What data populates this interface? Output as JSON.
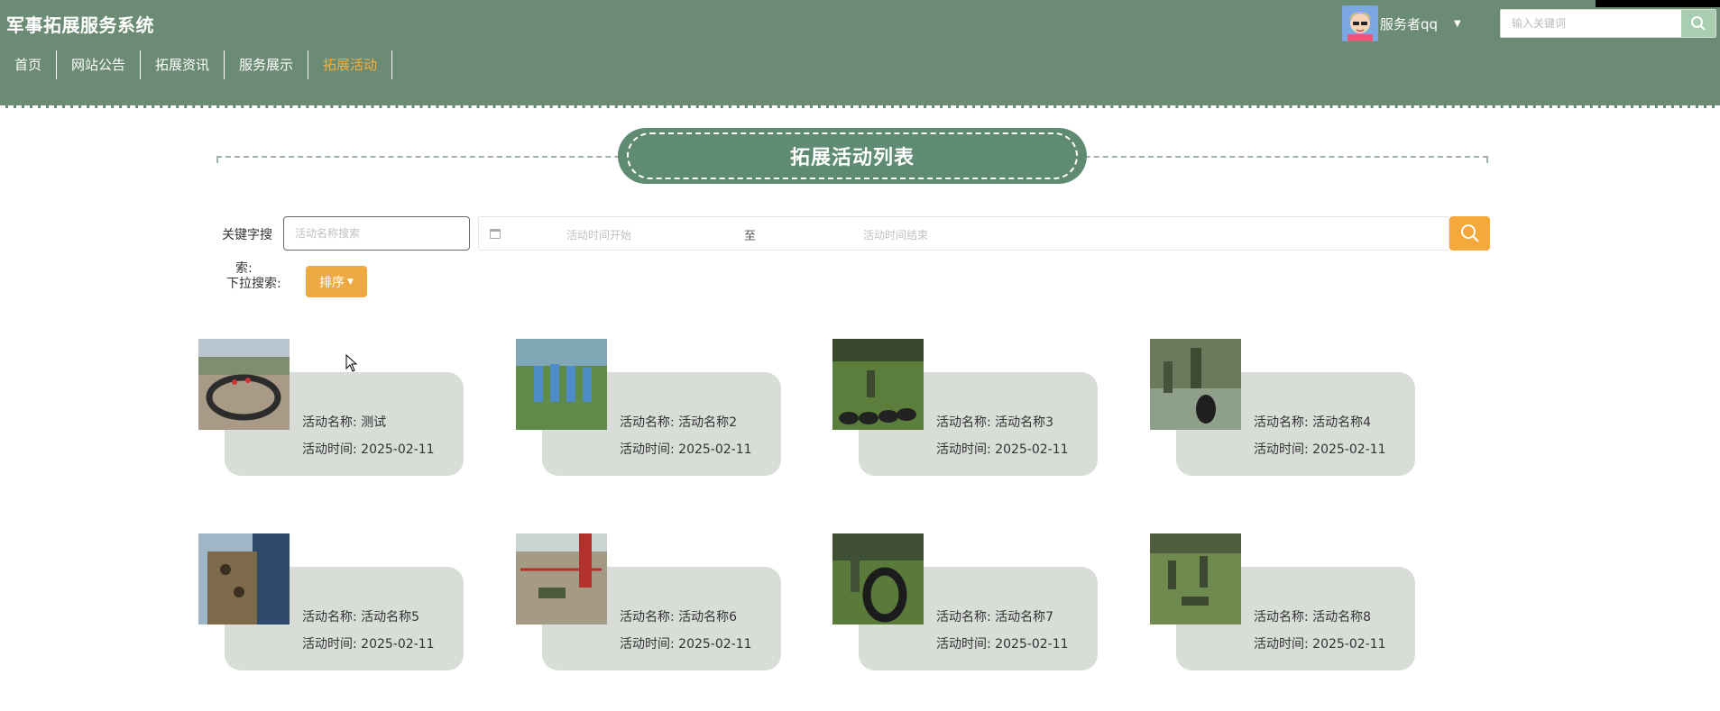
{
  "header": {
    "site_title": "军事拓展服务系统",
    "nav": [
      {
        "label": "首页",
        "active": false
      },
      {
        "label": "网站公告",
        "active": false
      },
      {
        "label": "拓展资讯",
        "active": false
      },
      {
        "label": "服务展示",
        "active": false
      },
      {
        "label": "拓展活动",
        "active": true
      }
    ],
    "user_name": "服务者qq",
    "search_placeholder": "输入关键词",
    "bg_color": "#6b8b74",
    "active_color": "#f1b03e"
  },
  "section": {
    "title": "拓展活动列表"
  },
  "filters": {
    "keyword_label_line1": "关键字搜",
    "keyword_label_line2": "索:",
    "keyword_placeholder": "活动名称搜索",
    "date_start_placeholder": "活动时间开始",
    "date_separator": "至",
    "date_end_placeholder": "活动时间结束",
    "dropdown_label": "下拉搜索:",
    "sort_label": "排序",
    "accent_color": "#f5a93b"
  },
  "activities": [
    {
      "name_label": "活动名称:",
      "name": "测试",
      "time_label": "活动时间:",
      "time": "2025-02-11"
    },
    {
      "name_label": "活动名称:",
      "name": "活动名称2",
      "time_label": "活动时间:",
      "time": "2025-02-11"
    },
    {
      "name_label": "活动名称:",
      "name": "活动名称3",
      "time_label": "活动时间:",
      "time": "2025-02-11"
    },
    {
      "name_label": "活动名称:",
      "name": "活动名称4",
      "time_label": "活动时间:",
      "time": "2025-02-11"
    },
    {
      "name_label": "活动名称:",
      "name": "活动名称5",
      "time_label": "活动时间:",
      "time": "2025-02-11"
    },
    {
      "name_label": "活动名称:",
      "name": "活动名称6",
      "time_label": "活动时间:",
      "time": "2025-02-11"
    },
    {
      "name_label": "活动名称:",
      "name": "活动名称7",
      "time_label": "活动时间:",
      "time": "2025-02-11"
    },
    {
      "name_label": "活动名称:",
      "name": "活动名称8",
      "time_label": "活动时间:",
      "time": "2025-02-11"
    }
  ],
  "icons": {
    "search": "search-icon",
    "calendar": "calendar-icon",
    "caret": "caret-down-icon"
  }
}
